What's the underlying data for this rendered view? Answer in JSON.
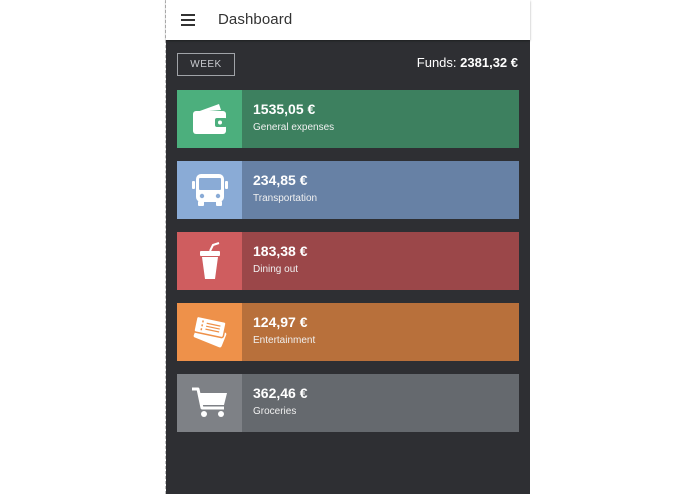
{
  "app_bar": {
    "title": "Dashboard",
    "menu_icon": "hamburger-menu-icon"
  },
  "summary": {
    "period_button": "WEEK",
    "funds_label": "Funds:",
    "funds_value": "2381,32 €"
  },
  "colors": {
    "app_bar_bg": "#ffffff",
    "content_bg": "#2e2f33"
  },
  "categories": [
    {
      "amount": "1535,05 €",
      "name": "General expenses",
      "icon": "wallet-icon",
      "icon_color": "#4caf7d",
      "body_color": "#3d805f"
    },
    {
      "amount": "234,85 €",
      "name": "Transportation",
      "icon": "bus-icon",
      "icon_color": "#8aabd6",
      "body_color": "#6781a5"
    },
    {
      "amount": "183,38 €",
      "name": "Dining out",
      "icon": "drink-cup-icon",
      "icon_color": "#cf5d5f",
      "body_color": "#9b4749"
    },
    {
      "amount": "124,97 €",
      "name": "Entertainment",
      "icon": "tickets-icon",
      "icon_color": "#ee914a",
      "body_color": "#b8703b"
    },
    {
      "amount": "362,46 €",
      "name": "Groceries",
      "icon": "shopping-cart-icon",
      "icon_color": "#7e8186",
      "body_color": "#65696e"
    }
  ]
}
